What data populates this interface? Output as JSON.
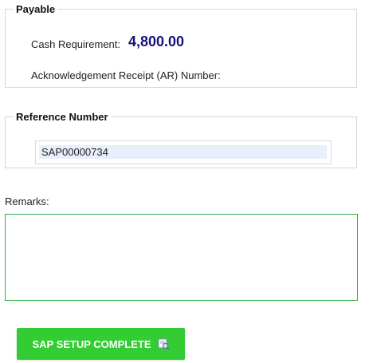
{
  "payable": {
    "legend": "Payable",
    "cash_requirement_label": "Cash Requirement:",
    "cash_requirement_value": "4,800.00",
    "ar_number_label": "Acknowledgement Receipt (AR) Number:"
  },
  "reference": {
    "legend": "Reference Number",
    "value": "SAP00000734"
  },
  "remarks": {
    "label": "Remarks:",
    "value": ""
  },
  "actions": {
    "complete_label": "SAP SETUP COMPLETE",
    "complete_icon": "wrench-magnifier-icon"
  },
  "colors": {
    "button_green": "#33cc33",
    "amount_navy": "#14147a",
    "remarks_border": "#2db33f",
    "input_highlight": "#e8eefa"
  }
}
